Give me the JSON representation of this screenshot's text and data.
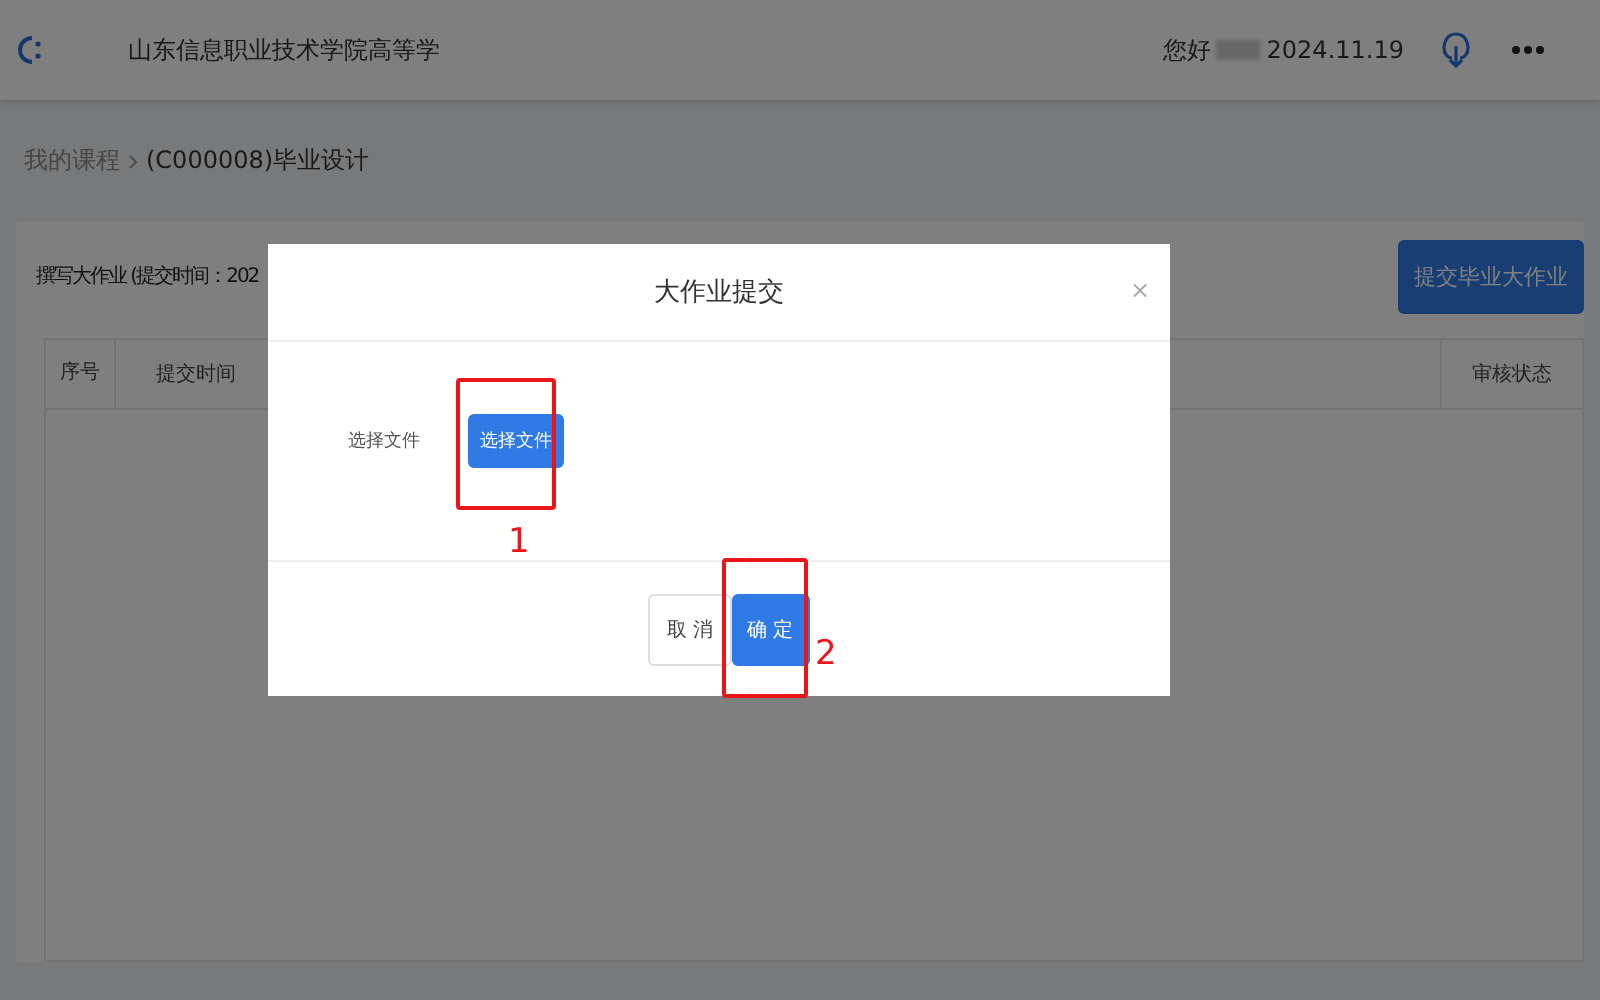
{
  "header": {
    "title": "山东信息职业技术学院高等学",
    "greeting": "您好",
    "date": "2024.11.19"
  },
  "breadcrumb": [
    {
      "label": "我的课程",
      "current": false
    },
    {
      "label": "(C000008)毕业设计",
      "current": true
    }
  ],
  "card": {
    "title": "撰写大作业 (提交时间：202",
    "button": "提交毕业大作业"
  },
  "table": {
    "columns": [
      "序号",
      "提交时间",
      "审核状态"
    ]
  },
  "dialog": {
    "title": "大作业提交",
    "close": "×",
    "field_label": "选择文件",
    "file_button": "选择文件",
    "buttons": [
      {
        "label": "取 消",
        "kind": "default"
      },
      {
        "label": "确 定",
        "kind": "primary"
      }
    ]
  },
  "annotations": [
    {
      "label": "1"
    },
    {
      "label": "2"
    }
  ]
}
